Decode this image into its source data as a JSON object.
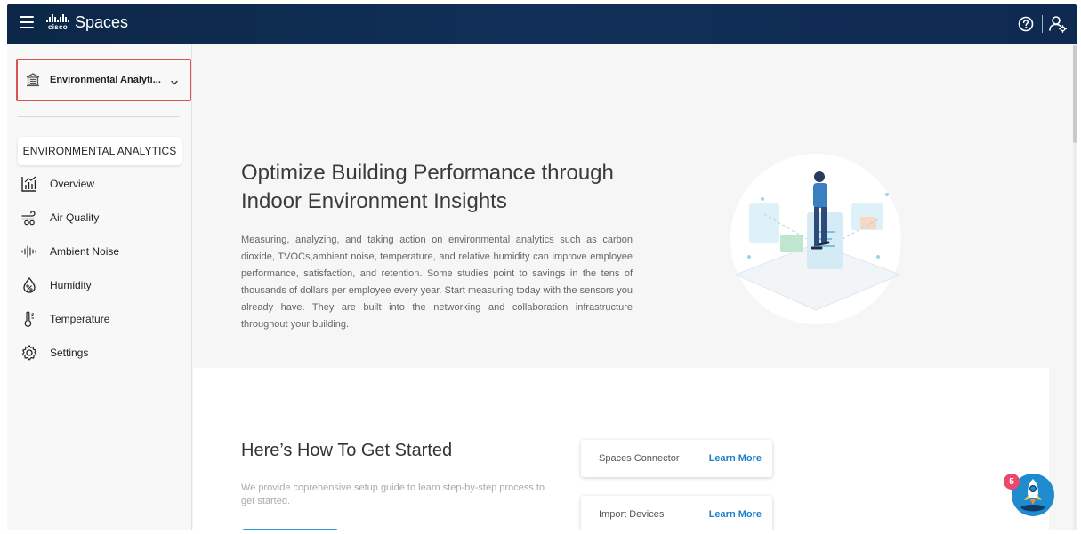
{
  "header": {
    "logo_text": "cisco",
    "app_title": "Spaces",
    "help_icon": "help-circle-icon",
    "user_icon": "user-settings-icon"
  },
  "sidebar": {
    "workspace": {
      "icon": "building-icon",
      "label": "Environmental Analyti...",
      "chevron": "chevron-down-icon"
    },
    "section_title": "ENVIRONMENTAL ANALYTICS",
    "items": [
      {
        "label": "Overview",
        "icon": "overview-chart-icon"
      },
      {
        "label": "Air Quality",
        "icon": "air-quality-icon"
      },
      {
        "label": "Ambient Noise",
        "icon": "ambient-noise-icon"
      },
      {
        "label": "Humidity",
        "icon": "humidity-icon"
      },
      {
        "label": "Temperature",
        "icon": "thermometer-icon"
      },
      {
        "label": "Settings",
        "icon": "gear-icon"
      }
    ]
  },
  "hero": {
    "title": "Optimize Building Performance through Indoor Environment Insights",
    "body": "Measuring, analyzing, and taking action on environmental analytics such as carbon dioxide, TVOCs,ambient noise, temperature, and relative humidity can improve employee performance, satisfaction, and retention. Some studies point to savings in the tens of thousands of dollars per employee every year. Start measuring today with the sensors you already have. They are built into the networking and collaboration infrastructure throughout your building."
  },
  "getting_started": {
    "title": "Here’s How To Get Started",
    "text": "We provide coprehensive setup guide to learn step-by-step process to get started.",
    "cards": [
      {
        "label": "Spaces Connector",
        "link": "Learn More"
      },
      {
        "label": "Import Devices",
        "link": "Learn More"
      }
    ]
  },
  "assistant": {
    "badge_count": "5",
    "icon": "rocket-assistant-icon"
  },
  "colors": {
    "header_bg": "#0f2a50",
    "accent_link": "#1b7fcc",
    "highlight_border": "#d9534f",
    "badge": "#e84a6b"
  }
}
